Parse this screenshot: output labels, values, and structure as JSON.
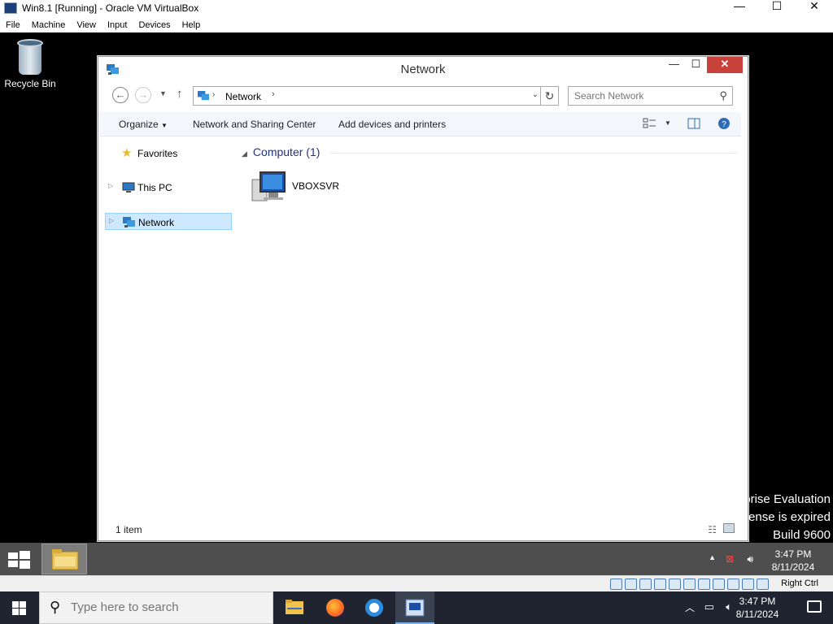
{
  "host_window": {
    "title": "Win8.1 [Running] - Oracle VM VirtualBox",
    "menu": [
      "File",
      "Machine",
      "View",
      "Input",
      "Devices",
      "Help"
    ],
    "controls": {
      "minimize": "—",
      "maximize": "☐",
      "close": "✕"
    }
  },
  "desktop": {
    "icons": [
      {
        "label": "Recycle Bin",
        "icon": "recycle-bin-icon"
      }
    ],
    "watermark": [
      "prise Evaluation",
      "cense is expired",
      "Build 9600"
    ]
  },
  "explorer": {
    "title": "Network",
    "address": {
      "crumb": "Network",
      "separator": "›"
    },
    "search": {
      "placeholder": "Search Network"
    },
    "toolbar": {
      "organize": "Organize",
      "network_sharing": "Network and Sharing Center",
      "add_devices": "Add devices and printers"
    },
    "nav": {
      "favorites": "Favorites",
      "this_pc": "This PC",
      "network": "Network"
    },
    "group": {
      "label": "Computer (1)"
    },
    "items": [
      {
        "label": "VBOXSVR",
        "icon": "computer-icon"
      }
    ],
    "status": {
      "count": "1 item"
    }
  },
  "guest_taskbar": {
    "time": "3:47 PM",
    "date": "8/11/2024"
  },
  "vbox_status": {
    "host_key": "Right Ctrl"
  },
  "host_taskbar": {
    "search_placeholder": "Type here to search",
    "time": "3:47 PM",
    "date": "8/11/2024"
  },
  "colors": {
    "close_red": "#c9413b",
    "selection": "#cde8ff",
    "group_header": "#1e3287",
    "taskbar_guest": "#4e4e4e",
    "taskbar_host": "#1f2430"
  }
}
